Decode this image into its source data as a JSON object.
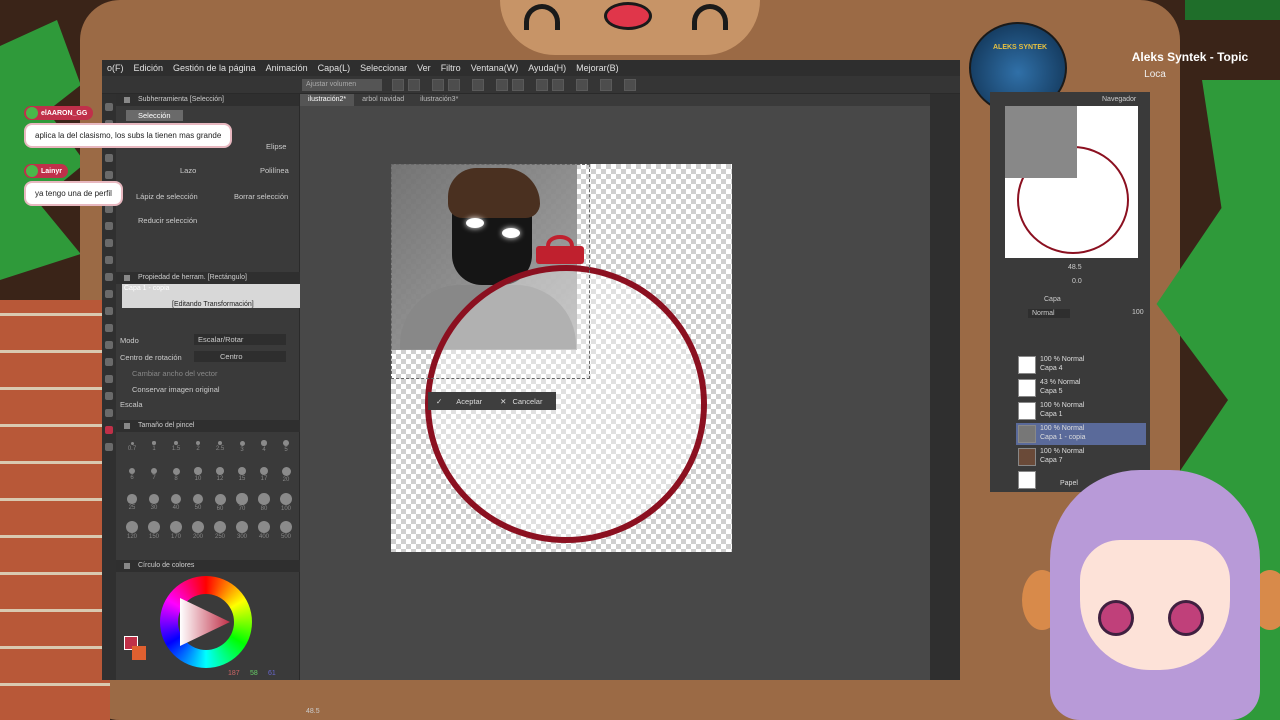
{
  "menu": [
    "o(F)",
    "Edición",
    "Gestión de la página",
    "Animación",
    "Capa(L)",
    "Seleccionar",
    "Ver",
    "Filtro",
    "Ventana(W)",
    "Ayuda(H)",
    "Mejorar(B)"
  ],
  "command_tab": "Ajustar volumen",
  "tool_panel": {
    "header": "Subherramienta [Selección]",
    "selected": "Selección",
    "items": [
      "Elipse",
      "Lazo",
      "Polilínea",
      "Lápiz de selección",
      "Borrar selección",
      "Reducir selección"
    ]
  },
  "tool_property": {
    "header": "Propiedad de herram. [Rectángulo]",
    "layer_name": "Capa 1 - copia",
    "status": "[Editando Transformación]",
    "mode_label": "Modo",
    "mode_value": "Escalar/Rotar",
    "center_label": "Centro de rotación",
    "center_value": "Centro",
    "opt1": "Cambiar ancho del vector",
    "opt2": "Conservar imagen original",
    "opt3": "Escala"
  },
  "brush_size": {
    "header": "Tamaño del pincel",
    "sizes": [
      "0.7",
      "1",
      "1.5",
      "2",
      "2.5",
      "3",
      "4",
      "5",
      "6",
      "7",
      "8",
      "10",
      "12",
      "15",
      "17",
      "20",
      "25",
      "30",
      "40",
      "50",
      "60",
      "70",
      "80",
      "100",
      "120",
      "150",
      "170",
      "200",
      "250",
      "300",
      "400",
      "500"
    ]
  },
  "color_wheel": {
    "header": "Círculo de colores",
    "rgb": [
      "187",
      "58",
      "61"
    ]
  },
  "doc_tabs": [
    "ilustración2*",
    "arbol navidad",
    "ilustración3*"
  ],
  "transform_buttons": {
    "accept": "Aceptar",
    "cancel": "Cancelar"
  },
  "chat": [
    {
      "user": "elAARON_GG",
      "message": "aplica la del clasismo, los subs la tienen mas grande"
    },
    {
      "user": "Lainyr",
      "message": "ya tengo una de perfil"
    }
  ],
  "now_playing": {
    "title": "Aleks Syntek - Topic",
    "subtitle": "Loca",
    "album_text": "ALEKS SYNTEK"
  },
  "navigator": {
    "header": "Navegador",
    "zoom": "48.5",
    "angle": "0.0"
  },
  "layers": {
    "header": "Capa",
    "blend": "Normal",
    "opacity": "100",
    "items": [
      {
        "l1": "100 % Normal",
        "l2": "Capa 4"
      },
      {
        "l1": "43 % Normal",
        "l2": "Capa 5"
      },
      {
        "l1": "100 % Normal",
        "l2": "Capa 1"
      },
      {
        "l1": "100 % Normal",
        "l2": "Capa 1 - copia"
      },
      {
        "l1": "100 % Normal",
        "l2": "Capa 7"
      },
      {
        "l1": "",
        "l2": "Papel"
      }
    ]
  },
  "status_zoom": "48.5",
  "colors": {
    "ornament": "#8b1020",
    "accent": "#c0304a",
    "tree": "#2f9a3a"
  }
}
